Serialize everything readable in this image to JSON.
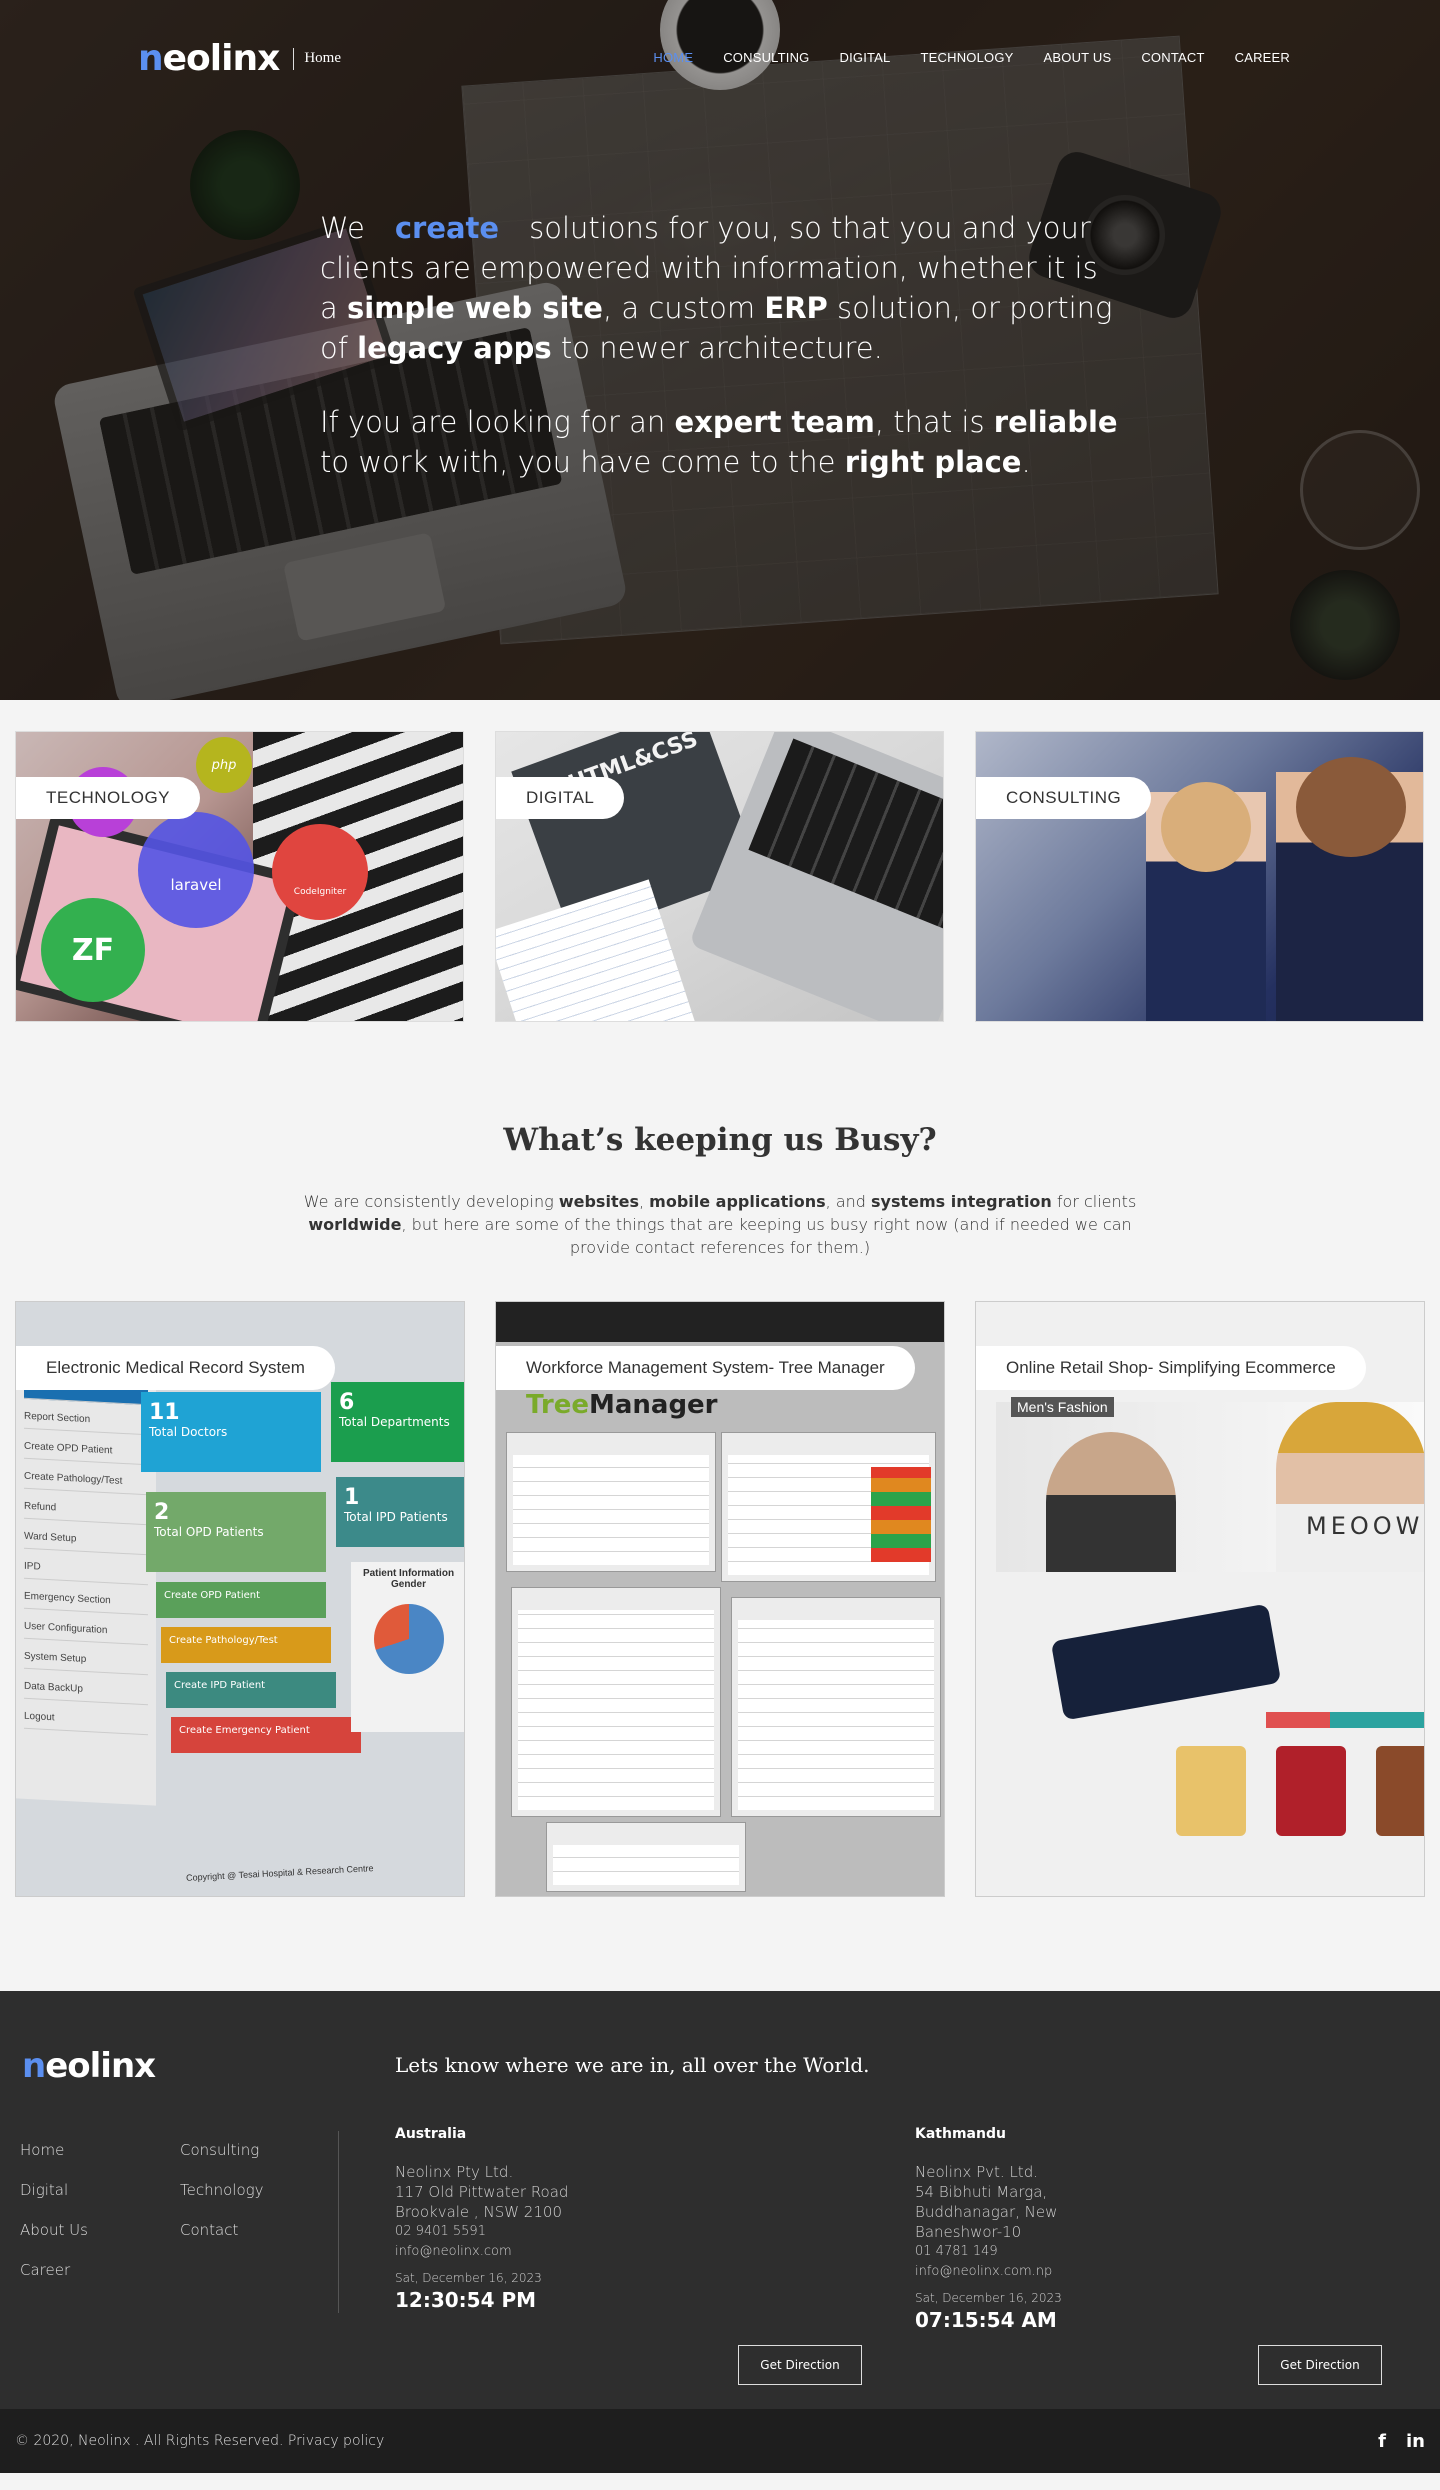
{
  "nav": {
    "logo_first": "n",
    "logo_rest": "eolinx",
    "breadcrumb": "Home",
    "items": [
      "HOME",
      "CONSULTING",
      "DIGITAL",
      "TECHNOLOGY",
      "ABOUT US",
      "CONTACT",
      "CAREER"
    ]
  },
  "hero": {
    "p1": {
      "we": "We",
      "highlight": "create",
      "t1": "solutions for you, so that you and your clients are empowered with information, whether it is a",
      "b1": "simple web site",
      "t2": ", a custom",
      "b2": "ERP",
      "t3": "solution, or porting of",
      "b3": "legacy apps",
      "t4": "to newer architecture."
    },
    "p2": {
      "t1": "If you are looking for an",
      "b1": "expert team",
      "t2": ", that is",
      "b2": "reliable",
      "t3": "to work with, you have come to the",
      "b3": "right place",
      "t4": "."
    }
  },
  "services": [
    "TECHNOLOGY",
    "DIGITAL",
    "CONSULTING"
  ],
  "service_art": {
    "laravel": "laravel",
    "php": "php",
    "zf": "ZF",
    "codeigniter": "CodeIgniter",
    "html_css": "HTML&CSS"
  },
  "busy": {
    "title": "What’s keeping us Busy?",
    "t1": "We are consistently developing",
    "b1": "websites",
    "t2": ",",
    "b2": "mobile applications",
    "t3": ", and",
    "b3": "systems integration",
    "t4": "for clients",
    "b4": "worldwide",
    "t5": ", but here are some of the things that are keeping us busy right now (and if needed we can provide contact references for them.)"
  },
  "projects": [
    "Electronic Medical Record System",
    "Workforce Management System- Tree Manager",
    "Online Retail Shop- Simplifying Ecommerce"
  ],
  "emr": {
    "menu": [
      "Report Section",
      "Create OPD Patient",
      "Create Pathology/Test",
      "Refund",
      "Ward Setup",
      "IPD",
      "Emergency Section",
      "User Configuration",
      "System Setup",
      "Data BackUp",
      "Logout"
    ],
    "tiles": [
      {
        "num": "11",
        "label": "Total Doctors"
      },
      {
        "num": "6",
        "label": "Total Departments"
      },
      {
        "num": "2",
        "label": "Total OPD Patients"
      },
      {
        "num": "1",
        "label": "Total IPD Patients"
      }
    ],
    "buttons": [
      "Create OPD Patient",
      "Create Pathology/Test",
      "Create IPD Patient",
      "Create Emergency Patient"
    ],
    "chart_label": "Patient Information Gender",
    "footer": "Copyright @ Tesai Hospital & Research Centre"
  },
  "tree_manager": {
    "logo_a": "Tree",
    "logo_b": "Manager"
  },
  "retail": {
    "banner_text": "Men's Fashion",
    "brand": "MEOOW"
  },
  "footer": {
    "logo_first": "n",
    "logo_rest": "eolinx",
    "tagline": "Lets know where we are in, all over the World.",
    "links": [
      "Home",
      "Consulting",
      "Digital",
      "Technology",
      "About Us",
      "Contact",
      "Career"
    ],
    "offices": [
      {
        "city": "Australia",
        "lines": [
          "Neolinx Pty Ltd.",
          "117 Old Pittwater Road",
          "Brookvale , NSW 2100"
        ],
        "phone": "02 9401 5591",
        "email": "info@neolinx.com",
        "date": "Sat, December 16, 2023",
        "time": "12:30:54 PM",
        "button": "Get Direction"
      },
      {
        "city": "Kathmandu",
        "lines": [
          "Neolinx Pvt. Ltd.",
          "54 Bibhuti Marga,",
          "Buddhanagar, New",
          "Baneshwor-10"
        ],
        "phone": "01 4781 149",
        "email": "info@neolinx.com.np",
        "date": "Sat, December 16, 2023",
        "time": "07:15:54 AM",
        "button": "Get Direction"
      }
    ],
    "copyright": "© 2020, Neolinx . All Rights Reserved.",
    "privacy": "Privacy policy",
    "social": [
      "facebook-icon",
      "linkedin-icon"
    ]
  },
  "colors": {
    "accent": "#5b8ff0",
    "footer_bg": "#2e2e2e",
    "page_bg": "#f4f4f4"
  }
}
